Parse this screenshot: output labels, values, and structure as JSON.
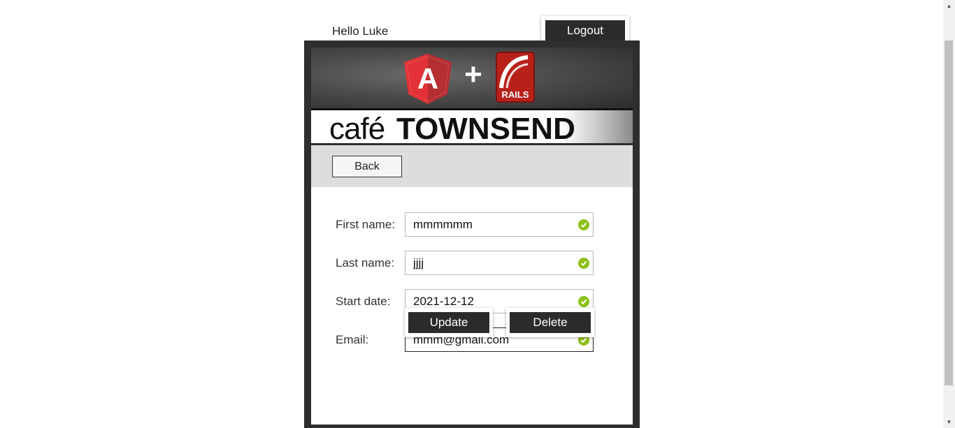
{
  "header": {
    "greeting": "Hello Luke",
    "logout_label": "Logout"
  },
  "banner": {
    "cafe_text": "café",
    "townsend_text": "TOWNSEND",
    "rails_text": "RAILS",
    "angular_letter": "A",
    "plus_text": "+"
  },
  "toolbar": {
    "back_label": "Back"
  },
  "form": {
    "first_name": {
      "label": "First name:",
      "value": "mmmmmm"
    },
    "last_name": {
      "label": "Last name:",
      "value": "jjjj"
    },
    "start_date": {
      "label": "Start date:",
      "value": "2021-12-12"
    },
    "email": {
      "label": "Email:",
      "value": "mmm@gmail.com"
    }
  },
  "actions": {
    "update_label": "Update",
    "delete_label": "Delete"
  },
  "colors": {
    "dark": "#2b2b2b",
    "valid_green": "#8dc11a",
    "angular_red": "#dd3a2b",
    "rails_red": "#b8211a"
  }
}
